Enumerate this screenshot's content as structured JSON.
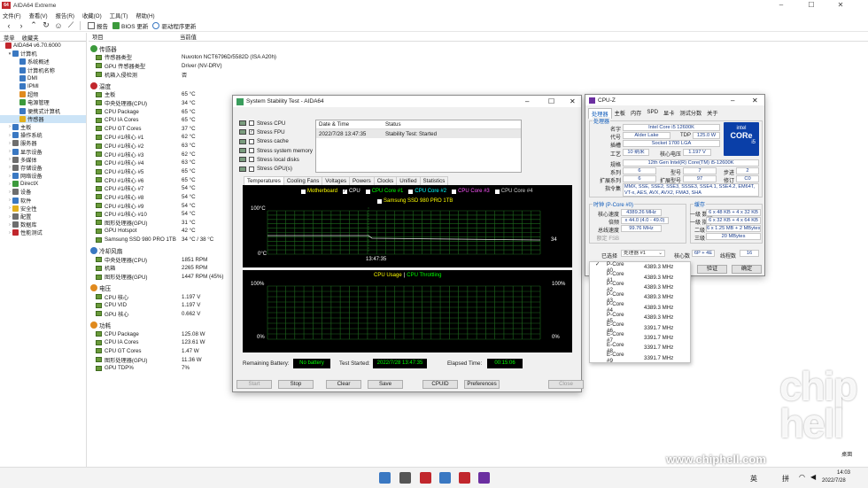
{
  "app": {
    "title": "AIDA64 Extreme",
    "icon_text": "64"
  },
  "menu": [
    "文件(F)",
    "查看(V)",
    "报告(R)",
    "收藏(O)",
    "工具(T)",
    "帮助(H)"
  ],
  "toolbar": {
    "report": "报告",
    "bios_update": "BIOS 更新",
    "driver_update": "驱动程序更新"
  },
  "left_tabs": [
    "菜单",
    "收藏夹"
  ],
  "tree": [
    {
      "label": "AIDA64 v6.70.6000",
      "level": 0,
      "exp": "",
      "color": "#c1272d"
    },
    {
      "label": "计算机",
      "level": 1,
      "exp": "▾",
      "color": "#3a78c2"
    },
    {
      "label": "系统概述",
      "level": 2,
      "exp": "",
      "color": "#3a78c2"
    },
    {
      "label": "计算机名称",
      "level": 2,
      "exp": "",
      "color": "#3a78c2"
    },
    {
      "label": "DMI",
      "level": 2,
      "exp": "",
      "color": "#3a78c2"
    },
    {
      "label": "IPMI",
      "level": 2,
      "exp": "",
      "color": "#3a78c2"
    },
    {
      "label": "超频",
      "level": 2,
      "exp": "",
      "color": "#e08a1e"
    },
    {
      "label": "电源管理",
      "level": 2,
      "exp": "",
      "color": "#3c9a3c"
    },
    {
      "label": "便携式计算机",
      "level": 2,
      "exp": "",
      "color": "#3a78c2"
    },
    {
      "label": "传感器",
      "level": 2,
      "exp": "",
      "color": "#e2b01e",
      "selected": true
    },
    {
      "label": "主板",
      "level": 1,
      "exp": "›",
      "color": "#3a78c2"
    },
    {
      "label": "操作系统",
      "level": 1,
      "exp": "›",
      "color": "#3a78c2"
    },
    {
      "label": "服务器",
      "level": 1,
      "exp": "›",
      "color": "#6e6e6e"
    },
    {
      "label": "显示设备",
      "level": 1,
      "exp": "›",
      "color": "#3a78c2"
    },
    {
      "label": "多媒体",
      "level": 1,
      "exp": "›",
      "color": "#6e6e6e"
    },
    {
      "label": "存储设备",
      "level": 1,
      "exp": "›",
      "color": "#6e6e6e"
    },
    {
      "label": "网络设备",
      "level": 1,
      "exp": "›",
      "color": "#3a78c2"
    },
    {
      "label": "DirectX",
      "level": 1,
      "exp": "›",
      "color": "#3c9a3c"
    },
    {
      "label": "设备",
      "level": 1,
      "exp": "›",
      "color": "#6e6e6e"
    },
    {
      "label": "软件",
      "level": 1,
      "exp": "›",
      "color": "#3a78c2"
    },
    {
      "label": "安全性",
      "level": 1,
      "exp": "›",
      "color": "#e2b01e"
    },
    {
      "label": "配置",
      "level": 1,
      "exp": "›",
      "color": "#6e6e6e"
    },
    {
      "label": "数据库",
      "level": 1,
      "exp": "›",
      "color": "#6e6e6e"
    },
    {
      "label": "性能测试",
      "level": 1,
      "exp": "›",
      "color": "#c1272d"
    }
  ],
  "columns": {
    "item": "项目",
    "value": "当前值"
  },
  "groups": [
    {
      "title": "传感器",
      "color": "#3c9a3c",
      "rows": [
        [
          "传感器类型",
          "Nuvoton NCT6796D/5582D  (ISA A20h)"
        ],
        [
          "GPU 传感器类型",
          "Driver  (NV-DRV)"
        ],
        [
          "机箱入侵检测",
          "否"
        ]
      ]
    },
    {
      "title": "温度",
      "color": "#c1272d",
      "rows": [
        [
          "主板",
          "65 °C"
        ],
        [
          "中央处理器(CPU)",
          "34 °C"
        ],
        [
          "CPU Package",
          "65 °C"
        ],
        [
          "CPU IA Cores",
          "65 °C"
        ],
        [
          "CPU GT Cores",
          "37 °C"
        ],
        [
          "CPU #1/核心 #1",
          "62 °C"
        ],
        [
          "CPU #1/核心 #2",
          "63 °C"
        ],
        [
          "CPU #1/核心 #3",
          "62 °C"
        ],
        [
          "CPU #1/核心 #4",
          "63 °C"
        ],
        [
          "CPU #1/核心 #5",
          "65 °C"
        ],
        [
          "CPU #1/核心 #6",
          "65 °C"
        ],
        [
          "CPU #1/核心 #7",
          "54 °C"
        ],
        [
          "CPU #1/核心 #8",
          "54 °C"
        ],
        [
          "CPU #1/核心 #9",
          "54 °C"
        ],
        [
          "CPU #1/核心 #10",
          "54 °C"
        ],
        [
          "图形处理器(GPU)",
          "31 °C"
        ],
        [
          "GPU Hotspot",
          "42 °C"
        ],
        [
          "Samsung SSD 980 PRO 1TB",
          "34 °C / 38 °C"
        ]
      ]
    },
    {
      "title": "冷却风扇",
      "color": "#3a78c2",
      "rows": [
        [
          "中央处理器(CPU)",
          "1851 RPM"
        ],
        [
          "机箱",
          "2265 RPM"
        ],
        [
          "图形处理器(GPU)",
          "1447 RPM  (45%)"
        ]
      ]
    },
    {
      "title": "电压",
      "color": "#e08a1e",
      "rows": [
        [
          "CPU 核心",
          "1.197 V"
        ],
        [
          "CPU VID",
          "1.197 V"
        ],
        [
          "GPU 核心",
          "0.662 V"
        ]
      ]
    },
    {
      "title": "功耗",
      "color": "#e08a1e",
      "rows": [
        [
          "CPU Package",
          "125.08 W"
        ],
        [
          "CPU IA Cores",
          "123.61 W"
        ],
        [
          "CPU GT Cores",
          "1.47 W"
        ],
        [
          "图形处理器(GPU)",
          "11.36 W"
        ],
        [
          "GPU TDP%",
          "7%"
        ]
      ]
    }
  ],
  "stability": {
    "title": "System Stability Test - AIDA64",
    "checks": [
      [
        "Stress CPU",
        false
      ],
      [
        "Stress FPU",
        true
      ],
      [
        "Stress cache",
        false
      ],
      [
        "Stress system memory",
        false
      ],
      [
        "Stress local disks",
        false
      ],
      [
        "Stress GPU(s)",
        false
      ]
    ],
    "log_headers": [
      "Date & Time",
      "Status"
    ],
    "log_row": [
      "2022/7/28 13:47:35",
      "Stability Test: Started"
    ],
    "tabs": [
      "Temperatures",
      "Cooling Fans",
      "Voltages",
      "Powers",
      "Clocks",
      "Unified",
      "Statistics"
    ],
    "legend": [
      [
        "Motherboard",
        false,
        "#ffff00"
      ],
      [
        "CPU",
        true,
        "#ffffff"
      ],
      [
        "CPU Core #1",
        false,
        "#00ff00"
      ],
      [
        "CPU Core #2",
        false,
        "#00ffff"
      ],
      [
        "CPU Core #3",
        false,
        "#ff55ff"
      ],
      [
        "CPU Core #4",
        false,
        "#cccccc"
      ]
    ],
    "legend2": [
      "Samsung SSD 980 PRO 1TB",
      false,
      "#ffff00"
    ],
    "temp_graph": {
      "ymax": "100°C",
      "ymin": "0°C",
      "time": "13:47:35",
      "current": "34"
    },
    "usage_graph": {
      "label1": "CPU Usage",
      "sep": "|",
      "label2": "CPU Throttling",
      "ymax_left": "100%",
      "ymin_left": "0%",
      "ymax_right": "100%",
      "ymin_right": "0%"
    },
    "battery_label": "Remaining Battery:",
    "battery": "No battery",
    "started_label": "Test Started:",
    "started": "2022/7/28 13:47:35",
    "elapsed_label": "Elapsed Time:",
    "elapsed": "00:15:06",
    "buttons": [
      "Start",
      "Stop",
      "Clear",
      "Save",
      "CPUID",
      "Preferences",
      "Close"
    ]
  },
  "cpuz": {
    "title": "CPU-Z",
    "tabs": [
      "处理器",
      "主板",
      "内存",
      "SPD",
      "显卡",
      "测试分数",
      "关于"
    ],
    "processor": "处理器",
    "labels": {
      "name": "名字",
      "code": "代号",
      "package": "插槽",
      "tech": "工艺",
      "voltage": "核心电压",
      "spec": "规格",
      "family": "系列",
      "model": "型号",
      "stepping": "步进",
      "ext_family": "扩展系列",
      "ext_model": "扩展型号",
      "revision": "修订",
      "instructions": "指令集",
      "tdp": "TDP"
    },
    "values": {
      "name": "Intel Core i5 12600K",
      "code": "Alder Lake",
      "tdp": "125.0 W",
      "package": "Socket 1700 LGA",
      "tech": "10 纳米",
      "voltage": "1.197 V",
      "spec": "12th Gen Intel(R) Core(TM) i5-12600K",
      "family": "6",
      "model": "7",
      "stepping": "2",
      "ext_family": "6",
      "ext_model": "97",
      "revision": "C0",
      "instructions": "MMX, SSE, SSE2, SSE3, SSSE3, SSE4.1, SSE4.2, EM64T, VT-x, AES, AVX, AVX2, FMA3, SHA"
    },
    "clocks": {
      "legend": "时钟 (P-Core #0)",
      "core_speed_l": "核心速度",
      "core_speed": "4389.26 MHz",
      "mult_l": "倍频",
      "mult": "x 44.0 (4.0 - 49.0)",
      "bus_l": "总线速度",
      "bus": "99.76 MHz",
      "fsb_l": "额定 FSB"
    },
    "cache": {
      "legend": "缓存",
      "l1d_l": "一级 数据",
      "l1d": "6 x 48 KB + 4 x 32 KB",
      "l1i_l": "一级 指令",
      "l1i": "6 x 32 KB + 4 x 64 KB",
      "l2_l": "二级",
      "l2": "6 x 1.25 MB + 2 MBytes",
      "l3_l": "三级",
      "l3": "20 MBytes"
    },
    "selection_l": "已选择",
    "selection": "处理器 #1",
    "cores_l": "核心数",
    "cores": "6P + 4E",
    "threads_l": "线程数",
    "threads": "16",
    "validate": "验证",
    "ok": "确定",
    "logo": {
      "brand": "intel",
      "line": "CORe",
      "tier": "i5"
    }
  },
  "dropdown": [
    [
      "P-Core #0",
      "4389.3 MHz",
      true
    ],
    [
      "P-Core #1",
      "4389.3 MHz",
      false
    ],
    [
      "P-Core #2",
      "4389.3 MHz",
      false
    ],
    [
      "P-Core #3",
      "4389.3 MHz",
      false
    ],
    [
      "P-Core #4",
      "4389.3 MHz",
      false
    ],
    [
      "P-Core #5",
      "4389.3 MHz",
      false
    ],
    [
      "E-Core #6",
      "3391.7 MHz",
      false
    ],
    [
      "E-Core #7",
      "3391.7 MHz",
      false
    ],
    [
      "E-Core #8",
      "3391.7 MHz",
      false
    ],
    [
      "E-Core #9",
      "3391.7 MHz",
      false
    ]
  ],
  "watermark": {
    "logo": "chip hell",
    "url": "www.chiphell.com"
  },
  "taskbar": {
    "desktop": "桌面",
    "lang": "英",
    "ime": "拼",
    "time": "14:03",
    "date": "2022/7/28"
  }
}
